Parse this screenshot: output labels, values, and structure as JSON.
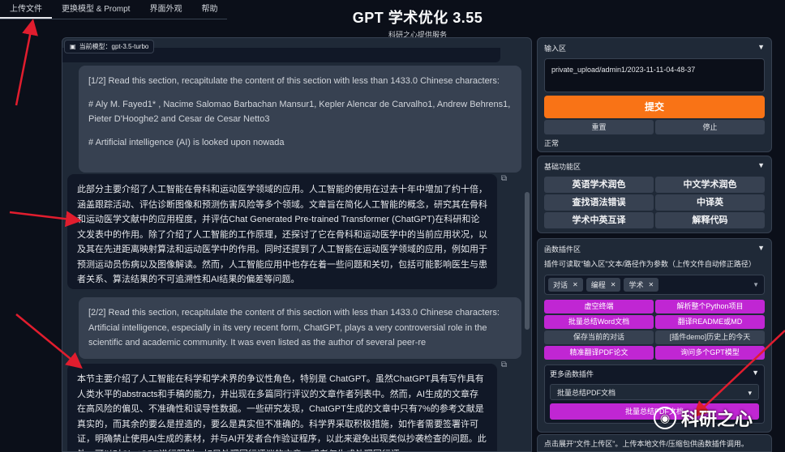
{
  "menu": {
    "tabs": [
      "上传文件",
      "更换模型 & Prompt",
      "界面外观",
      "帮助"
    ]
  },
  "header": {
    "title": "GPT 学术优化 3.55",
    "subtitle": "科研之心提供服务"
  },
  "chat": {
    "model_label": "当前模型：gpt-3.5-turbo",
    "messages": [
      {
        "role": "user",
        "paragraphs": [
          "[1/2] Read this section, recapitulate the content of this section with less than 1433.0 Chinese characters:",
          "# Aly M. Fayed1*  , Nacime Salomao Barbachan Mansur1, Kepler Alencar de Carvalho1, Andrew Behrens1,  Pieter D'Hooghe2 and Cesar de Cesar Netto3",
          "# Artificial intelligence (AI) is looked upon nowada"
        ]
      },
      {
        "role": "bot",
        "paragraphs": [
          "此部分主要介绍了人工智能在骨科和运动医学领域的应用。人工智能的使用在过去十年中增加了约十倍，涵盖跟踪活动、评估诊断图像和预测伤害风险等多个领域。文章旨在简化人工智能的概念，研究其在骨科和运动医学文献中的应用程度，并评估Chat Generated Pre-trained Transformer (ChatGPT)在科研和论文发表中的作用。除了介绍了人工智能的工作原理，还探讨了它在骨科和运动医学中的当前应用状况，以及其在先进距离映射算法和运动医学中的作用。同时还提到了人工智能在运动医学领域的应用，例如用于预测运动员伤病以及图像解读。然而，人工智能应用中也存在着一些问题和关切，包括可能影响医生与患者关系、算法结果的不可追溯性和AI结果的偏差等问题。"
        ]
      },
      {
        "role": "user",
        "paragraphs": [
          "[2/2] Read this section, recapitulate the content of this section with less than 1433.0 Chinese characters:  Artificial intelligence, especially in its very recent form,  ChatGPT, plays a very controversial role in the scientific  and academic community. It was even listed as the author  of several peer-re"
        ]
      },
      {
        "role": "bot",
        "paragraphs": [
          "本节主要介绍了人工智能在科学和学术界的争议性角色，特别是 ChatGPT。虽然ChatGPT具有写作具有人类水平的abstracts和手稿的能力，并出现在多篇同行评议的文章作者列表中。然而，AI生成的文章存在高风险的偏见、不准确性和误导性数据。一些研究发现，ChatGPT生成的文章中只有7%的参考文献是真实的，而其余的要么是捏造的，要么是真实但不准确的。科学界采取积极措施，如作者需要签署许可证，明确禁止使用AI生成的素材，并与AI开发者合作验证程序，以此来避免出现类似抄袭检查的问题。此外，可以对ChatGPT进行限制，如只处理同行评议的文章，或者仅生成处理同行评"
        ]
      }
    ]
  },
  "input_area": {
    "title": "输入区",
    "path_value": "private_upload/admin1/2023-11-11-04-48-37",
    "submit_label": "提交",
    "reset_label": "重置",
    "stop_label": "停止",
    "status": "正常"
  },
  "basic_functions": {
    "title": "基础功能区",
    "buttons": [
      "英语学术润色",
      "中文学术润色",
      "查找语法错误",
      "中译英",
      "学术中英互译",
      "解释代码"
    ]
  },
  "plugins": {
    "title": "函数插件区",
    "hint": "插件可读取\"输入区\"文本/路径作为参数（上传文件自动修正路径）",
    "chips": [
      "对话",
      "编程",
      "学术"
    ],
    "buttons": [
      {
        "label": "虚空终端",
        "style": "purple"
      },
      {
        "label": "解析整个Python项目",
        "style": "purple"
      },
      {
        "label": "批量总结Word文档",
        "style": "purple"
      },
      {
        "label": "翻译README或MD",
        "style": "purple"
      },
      {
        "label": "保存当前的对话",
        "style": "plain"
      },
      {
        "label": "[插件demo]历史上的今天",
        "style": "plain"
      },
      {
        "label": "精准翻译PDF论文",
        "style": "purple"
      },
      {
        "label": "询问多个GPT模型",
        "style": "purple"
      }
    ],
    "more_title": "更多函数插件",
    "more_selected": "批量总结PDF文档",
    "more_run_label": "批量总结PDF文档"
  },
  "upload_tip": "点击展开\"文件上传区\"。上传本地文件/压缩包供函数插件调用。",
  "watermark": "科研之心",
  "colors": {
    "background": "#0b0f19",
    "panel": "#1f2937",
    "submit": "#f97316",
    "plugin_button": "#c026d3",
    "annotation_arrow": "#e11d2e"
  }
}
